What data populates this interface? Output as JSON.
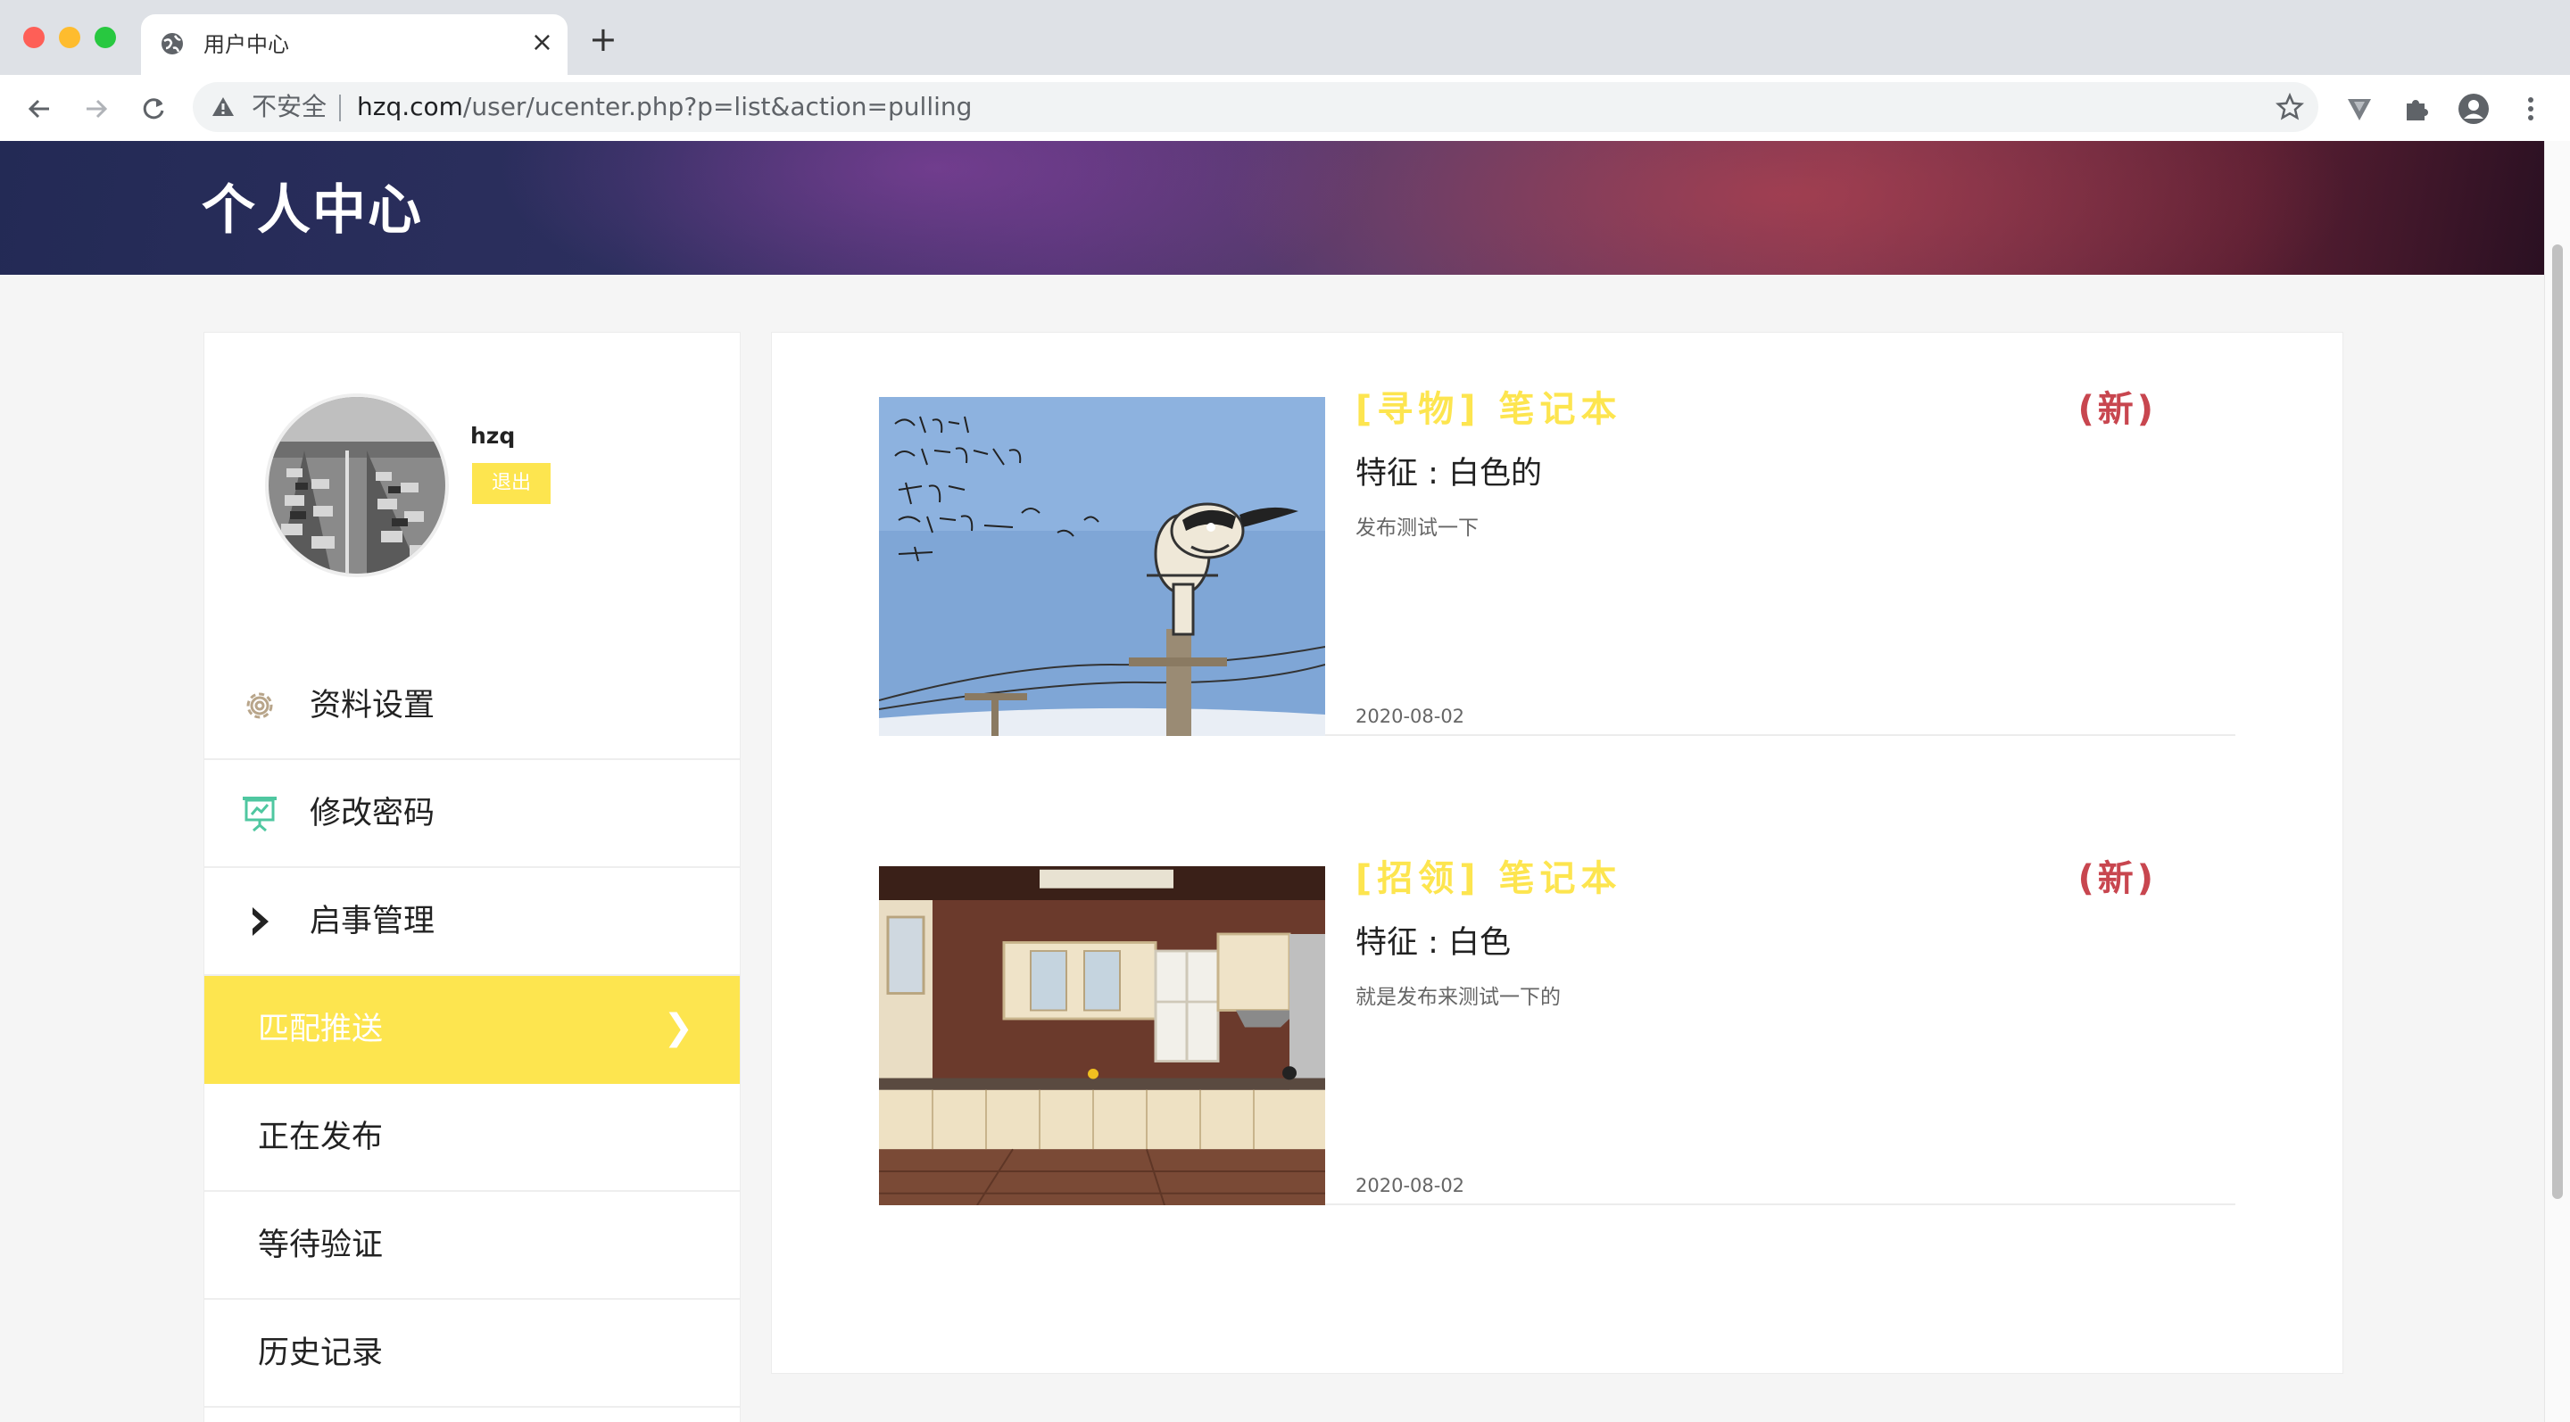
{
  "browser": {
    "tab_title": "用户中心",
    "tab_close": "×",
    "new_tab": "+",
    "security_label": "不安全",
    "url_host": "hzq.com",
    "url_path": "/user/ucenter.php?p=list&action=pulling"
  },
  "header": {
    "title": "个人中心"
  },
  "user": {
    "name": "hzq",
    "logout_label": "退出"
  },
  "menu": {
    "items": [
      {
        "label": "资料设置",
        "icon": "gear-icon"
      },
      {
        "label": "修改密码",
        "icon": "presentation-icon"
      },
      {
        "label": "启事管理",
        "icon": "chevron-right-icon"
      },
      {
        "label": "匹配推送",
        "active": true,
        "arrow": "❯"
      },
      {
        "label": "正在发布"
      },
      {
        "label": "等待验证"
      },
      {
        "label": "历史记录"
      }
    ]
  },
  "listings": [
    {
      "title": "[寻物] 笔记本",
      "tag": "(新)",
      "feature": "特征 : 白色的",
      "description": "发布测试一下",
      "date": "2020-08-02",
      "image": "cartoon-dog-on-pole"
    },
    {
      "title": "[招领] 笔记本",
      "tag": "(新)",
      "feature": "特征 : 白色",
      "description": "就是发布来测试一下的",
      "date": "2020-08-02",
      "image": "kitchen-photo"
    }
  ],
  "colors": {
    "accent_yellow": "#fde54f",
    "tag_red": "#c8464f",
    "banner_dark": "#232a55"
  }
}
